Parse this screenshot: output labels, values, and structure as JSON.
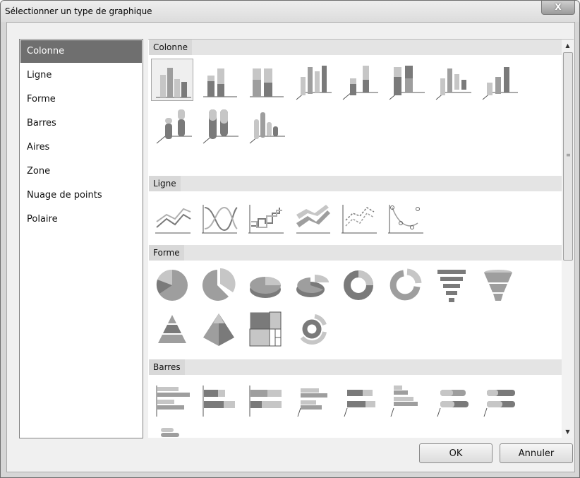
{
  "window": {
    "title": "Sélectionner un type de graphique",
    "close_glyph": "X"
  },
  "sidebar": {
    "items": [
      {
        "label": "Colonne",
        "selected": true
      },
      {
        "label": "Ligne"
      },
      {
        "label": "Forme"
      },
      {
        "label": "Barres"
      },
      {
        "label": "Aires"
      },
      {
        "label": "Zone"
      },
      {
        "label": "Nuage de points"
      },
      {
        "label": "Polaire"
      }
    ]
  },
  "gallery": {
    "sections": [
      {
        "label": "Colonne",
        "icons": [
          "clustered-column-icon",
          "stacked-column-icon",
          "full-stacked-column-icon",
          "3d-clustered-column-icon",
          "3d-stacked-column-icon",
          "3d-full-stacked-column-icon",
          "3d-column-icon",
          "3d-cylinder-column-icon",
          "3d-cylinder-stacked-icon",
          "3d-cylinder-full-stacked-icon",
          "3d-cylinder-clustered-icon"
        ]
      },
      {
        "label": "Ligne",
        "icons": [
          "line-icon",
          "smooth-line-icon",
          "stepped-line-icon",
          "3d-line-icon",
          "line-with-markers-icon",
          "smooth-line-with-markers-icon"
        ]
      },
      {
        "label": "Forme",
        "icons": [
          "pie-icon",
          "exploded-pie-icon",
          "3d-pie-icon",
          "3d-exploded-pie-icon",
          "doughnut-icon",
          "exploded-doughnut-icon",
          "funnel-icon",
          "3d-funnel-icon",
          "pyramid-icon",
          "3d-pyramid-icon",
          "treemap-icon",
          "sunburst-icon"
        ]
      },
      {
        "label": "Barres",
        "icons": [
          "clustered-bar-icon",
          "stacked-bar-icon",
          "full-stacked-bar-icon",
          "3d-clustered-bar-icon",
          "3d-stacked-bar-icon",
          "3d-full-stacked-bar-icon",
          "3d-cylinder-bar-icon",
          "3d-cylinder-stacked-bar-icon",
          "3d-cylinder-clustered-bar-icon"
        ]
      }
    ],
    "selected_icon": "clustered-column-icon"
  },
  "buttons": {
    "ok": "OK",
    "cancel": "Annuler"
  },
  "colors": {
    "selection": "#6f6f6f",
    "chart_dark": "#7a7a7a",
    "chart_mid": "#9e9e9e",
    "chart_light": "#c6c6c6"
  }
}
